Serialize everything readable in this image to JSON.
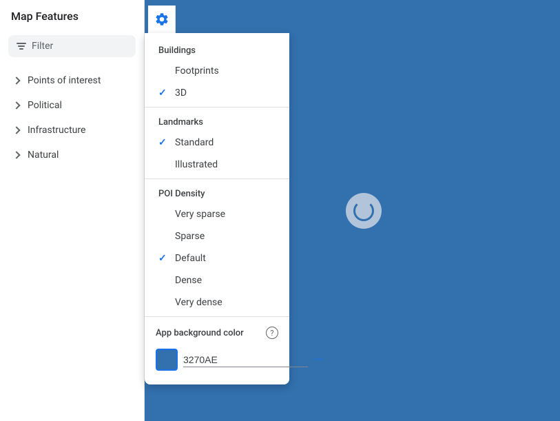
{
  "sidebar": {
    "title": "Map Features",
    "filter_placeholder": "Filter",
    "nav_items": [
      {
        "label": "Points of interest"
      },
      {
        "label": "Political"
      },
      {
        "label": "Infrastructure"
      },
      {
        "label": "Natural"
      }
    ]
  },
  "dropdown": {
    "buildings": {
      "section_label": "Buildings",
      "items": [
        {
          "label": "Footprints",
          "checked": false
        },
        {
          "label": "3D",
          "checked": true
        }
      ]
    },
    "landmarks": {
      "section_label": "Landmarks",
      "items": [
        {
          "label": "Standard",
          "checked": true
        },
        {
          "label": "Illustrated",
          "checked": false
        }
      ]
    },
    "poi_density": {
      "section_label": "POI Density",
      "items": [
        {
          "label": "Very sparse",
          "checked": false
        },
        {
          "label": "Sparse",
          "checked": false
        },
        {
          "label": "Default",
          "checked": true
        },
        {
          "label": "Dense",
          "checked": false
        },
        {
          "label": "Very dense",
          "checked": false
        }
      ]
    },
    "app_bg_color": {
      "label": "App background color",
      "color_value": "3270AE",
      "clear_label": "—"
    }
  },
  "gear_icon_label": "Settings",
  "help_icon_label": "?"
}
